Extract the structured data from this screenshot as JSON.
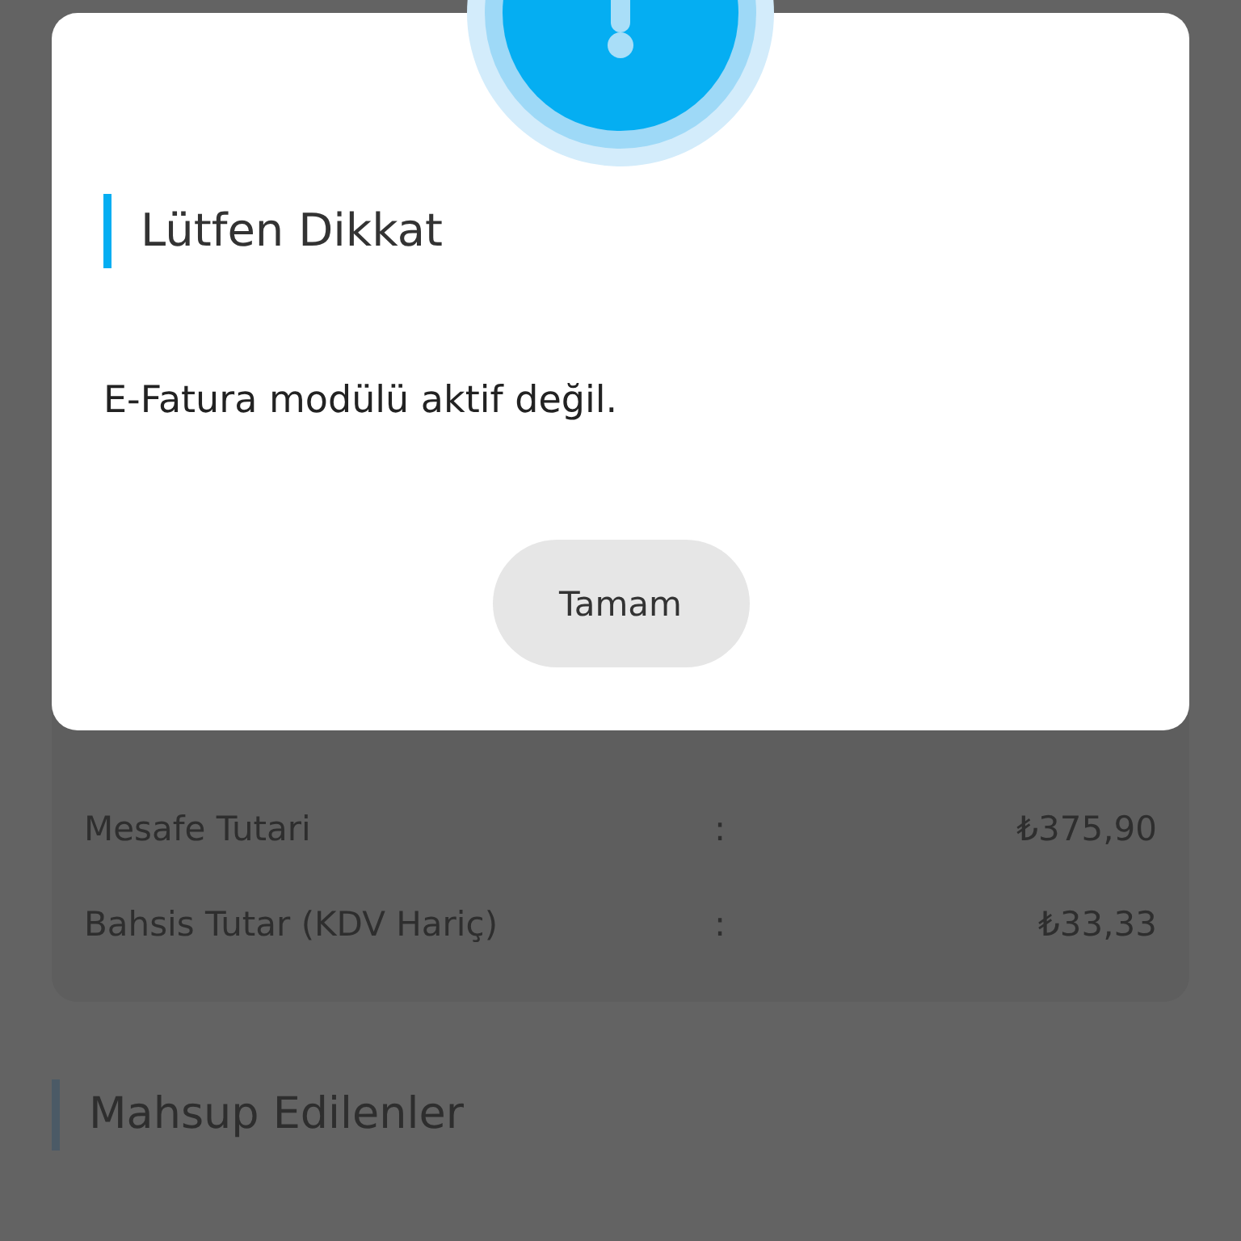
{
  "background": {
    "rows": [
      {
        "label": "Mesafe Tutari",
        "separator": ":",
        "value": "₺375,90"
      },
      {
        "label": "Bahsis Tutar (KDV Hariç)",
        "separator": ":",
        "value": "₺33,33"
      }
    ],
    "section_title": "Mahsup Edilenler"
  },
  "dialog": {
    "title": "Lütfen Dikkat",
    "message": "E-Fatura modülü aktif değil.",
    "button": "Tamam"
  }
}
